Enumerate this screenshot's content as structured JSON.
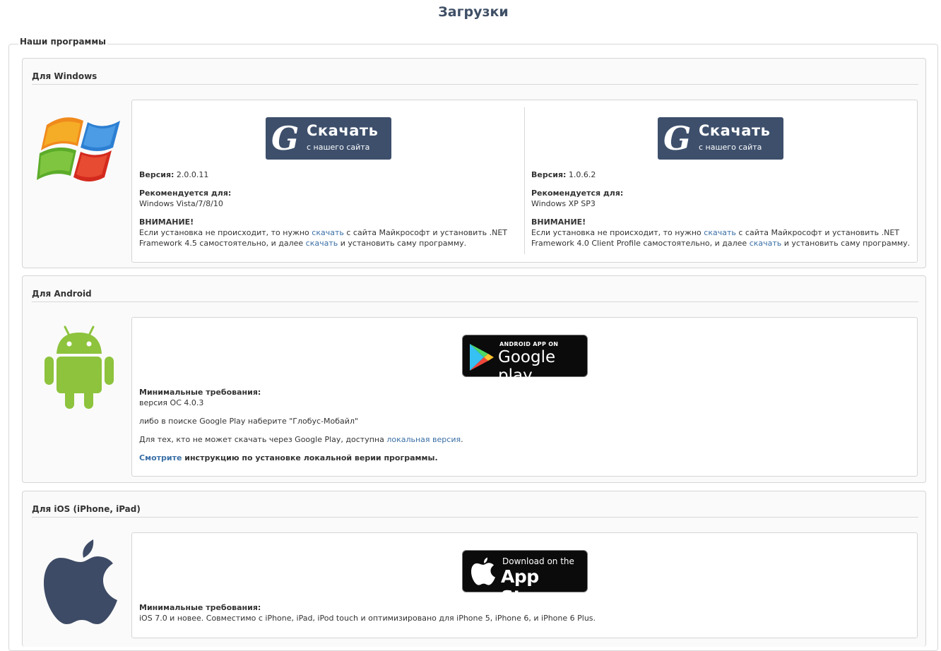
{
  "page_title": "Загрузки",
  "legend": "Наши программы",
  "windows": {
    "title": "Для Windows",
    "logo_icon": "windows-logo-icon",
    "items": [
      {
        "download_main": "Скачать",
        "download_sub": "с нашего сайта",
        "version_label": "Версия:",
        "version_value": "2.0.0.11",
        "recommended_label": "Рекомендуется для:",
        "recommended_value": "Windows Vista/7/8/10",
        "warning_label": "ВНИМАНИЕ!",
        "warning_p1": "Если установка не происходит, то нужно ",
        "link1": "скачать",
        "warning_p2": " с сайта Майкрософт и установить .NET",
        "warning_p3": "Framework 4.5 самостоятельно, и далее ",
        "link2": "скачать",
        "warning_p4": " и установить саму программу."
      },
      {
        "download_main": "Скачать",
        "download_sub": "с нашего сайта",
        "version_label": "Версия:",
        "version_value": "1.0.6.2",
        "recommended_label": "Рекомендуется для:",
        "recommended_value": "Windows XP SP3",
        "warning_label": "ВНИМАНИЕ!",
        "warning_p1": "Если установка не происходит, то нужно ",
        "link1": "скачать",
        "warning_p2": " с сайта Майкрософт и установить .NET",
        "warning_p3": "Framework 4.0 Client Profile самостоятельно, и далее ",
        "link2": "скачать",
        "warning_p4": " и установить саму программу."
      }
    ]
  },
  "android": {
    "title": "Для Android",
    "logo_icon": "android-logo-icon",
    "badge_top": "ANDROID APP ON",
    "badge_main": "Google play",
    "req_label": "Минимальные требования:",
    "req_value": "версия ОС 4.0.3",
    "search_text": "либо в поиске Google Play наберите \"Глобус-Мобайл\"",
    "local_p1": "Для тех, кто не может скачать через Google Play, доступна ",
    "local_link": "локальная версия",
    "local_p2": ".",
    "instr_link": "Смотрите",
    "instr_text": " инструкцию по установке локальной верии программы."
  },
  "ios": {
    "title": "Для iOS (iPhone, iPad)",
    "logo_icon": "apple-logo-icon",
    "badge_top": "Download on the",
    "badge_main": "App Store",
    "req_label": "Минимальные требования:",
    "req_value": "iOS 7.0 и новее. Совместимо с iPhone, iPad, iPod touch и оптимизировано для iPhone 5, iPhone 6, и iPhone 6 Plus."
  },
  "colors": {
    "title": "#3f4f66",
    "download_badge": "#3d4f6b",
    "link": "#3a6fa6"
  }
}
